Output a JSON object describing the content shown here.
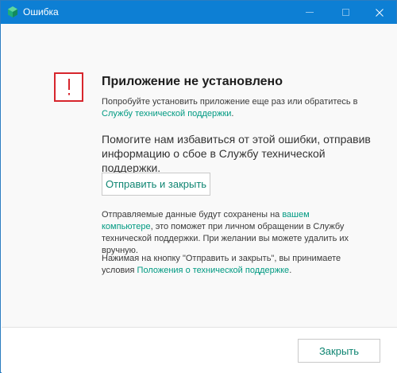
{
  "titlebar": {
    "title": "Ошибка",
    "app_icon": "green-shield-icon",
    "accent_color": "#0d7fd4"
  },
  "main": {
    "error_icon": "exclamation-icon",
    "error_color": "#d7262d",
    "heading": "Приложение не установлено",
    "p1_text": "Попробуйте установить приложение еще раз или обратитесь в ",
    "p1_link": "Службу технической поддержки",
    "p1_end": ".",
    "p2_text": "Помогите нам избавиться от этой ошибки, отправив информацию о сбое в Службу технической поддержки.",
    "send_button": "Отправить и закрыть",
    "p3_text": "Отправляемые данные будут сохранены на ",
    "p3_link": "вашем компьютере",
    "p3_end": ", это поможет при личном обращении в Службу технической поддержки. При желании вы можете удалить их вручную.",
    "p4_text": "Нажимая на кнопку \"Отправить и закрыть\", вы принимаете условия ",
    "p4_link": "Положения о технической поддержке",
    "p4_end": ".",
    "link_color": "#009a82"
  },
  "footer": {
    "close_button": "Закрыть"
  }
}
